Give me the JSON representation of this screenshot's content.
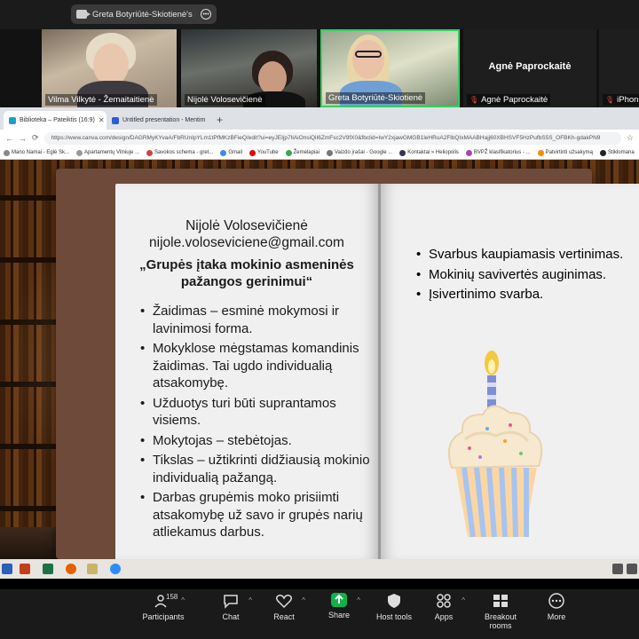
{
  "share_bar": {
    "label": "Greta Botyriūtė-Skiotienė's s"
  },
  "participants": [
    {
      "name": "Vilma Vilkytė - Žemaitaitienė"
    },
    {
      "name": "Nijolė Volosevičienė"
    },
    {
      "name": "Greta Botyriūtė-Skiotienė"
    },
    {
      "name": "Agnė Paprockaitė",
      "display": "Agnė Paprockaitė"
    },
    {
      "name": "iPhone"
    }
  ],
  "browser": {
    "tabs": [
      {
        "label": "Biblioteka – Pateiktis (16:9)",
        "active": true
      },
      {
        "label": "Untitled presentation - Mentim",
        "active": false
      }
    ],
    "new_tab": "+",
    "url": "https://www.canva.com/design/DAGRMyKYvaA/FbRUnIpYLm1tPfMKzBFieQ/edit?ui=eyJEIjp7IlAiOnsiQiI6ZmFsc2V9fX0&fbclid=IwY2xjawGMGB1leHRuA2FlbQIxMAABHajj60XBHSVF5HzPufbS5S_OFBKh-gdakPN9",
    "bookmarks": [
      "Mano Namai - Eglė Sk...",
      "Apartamentų Vilniuje ...",
      "Savokos schema - gret...",
      "Gmail",
      "YouTube",
      "Žemėlapiai",
      "Vaizdo įrašai - Google ...",
      "Kontaktai » Heliopolis",
      "BVPŽ klasifikatorius - ...",
      "Patvirtinti užsakymą",
      "Stiklomana"
    ]
  },
  "slide": {
    "author": "Nijolė Volosevičienė",
    "email": "nijole.voloseviciene@gmail.com",
    "title": "„Grupės įtaka mokinio asmeninės pažangos gerinimui“",
    "left_bullets": [
      "Žaidimas – esminė mokymosi ir lavinimosi forma.",
      "Mokyklose mėgstamas komandinis žaidimas. Tai ugdo individualią atsakomybę.",
      "Užduotys turi būti suprantamos visiems.",
      "Mokytojas – stebėtojas.",
      "Tikslas – užtikrinti didžiausią mokinio individualią pažangą.",
      "Darbas grupėmis moko prisiimti atsakomybę už savo ir grupės narių atliekamus darbus."
    ],
    "right_bullets": [
      "Svarbus kaupiamasis vertinimas.",
      "Mokinių savivertės auginimas.",
      "Įsivertinimo svarba."
    ]
  },
  "controls": {
    "participants_count": "158",
    "items": [
      "Participants",
      "Chat",
      "React",
      "Share",
      "Host tools",
      "Apps",
      "Breakout rooms",
      "More"
    ]
  },
  "colors": {
    "share_green": "#0fb34a",
    "active_speaker": "#2fd25d",
    "page_bg": "#f1f0f0"
  }
}
